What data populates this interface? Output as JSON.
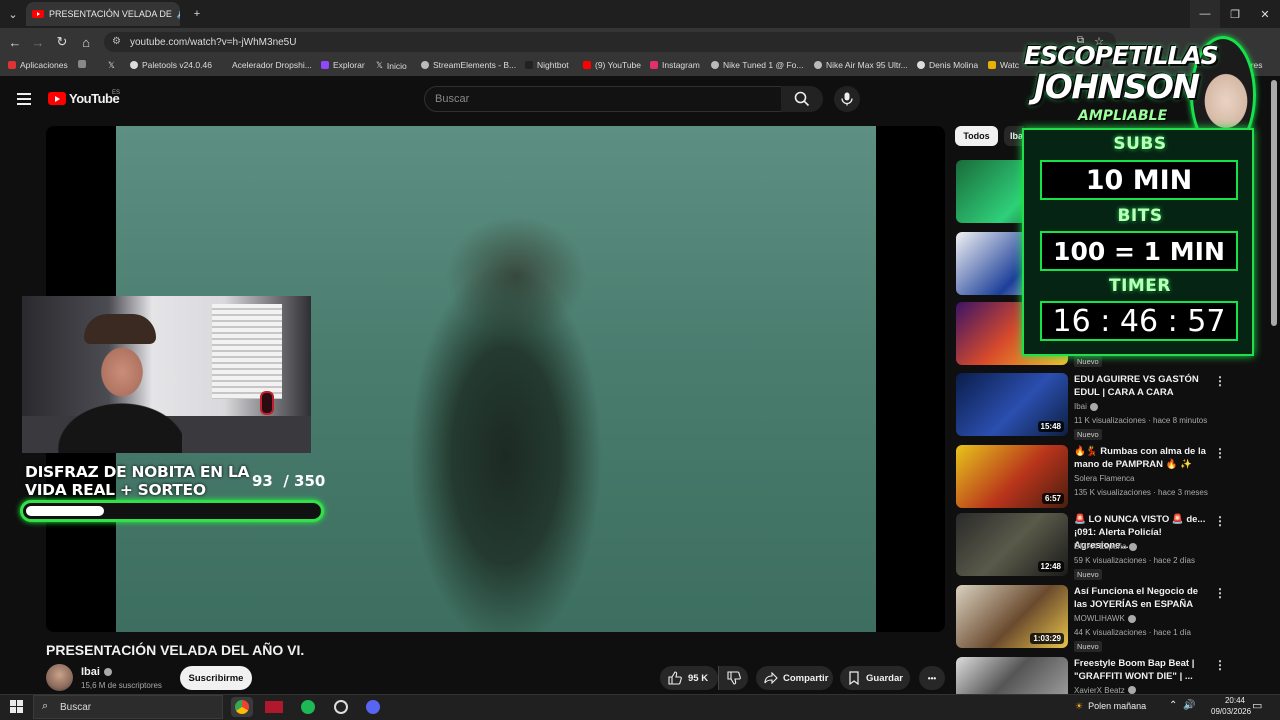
{
  "browser": {
    "tab_title": "PRESENTACIÓN VELADA DE",
    "url": "youtube.com/watch?v=h-jWhM3ne5U",
    "window_controls": {
      "minimize": "—",
      "restore": "❐",
      "close": "✕"
    },
    "bookmarks": [
      "Aplicaciones",
      "Paletools v24.0.46",
      "Acelerador Dropshi...",
      "Explorar",
      "Inicio",
      "StreamElements - B...",
      "Nightbot",
      "(9) YouTube",
      "Instagram",
      "Nike Tuned 1 @ Fo...",
      "Nike Air Max 95 Ultr...",
      "Denis Molina",
      "Watc",
      "bres"
    ]
  },
  "youtube": {
    "logo": "YouTube",
    "region": "ES",
    "search_placeholder": "Buscar",
    "chips": [
      "Todos",
      "Iba"
    ]
  },
  "video": {
    "title": "PRESENTACIÓN VELADA DEL AÑO VI.",
    "channel": "Ibai",
    "subscribers": "15,6 M de suscriptores",
    "subscribe_label": "Suscribirme",
    "likes": "95 K",
    "share_label": "Compartir",
    "save_label": "Guardar",
    "more_label": "•••"
  },
  "stream_goal": {
    "title_line1": "DISFRAZ DE NOBITA EN LA",
    "title_line2": "VIDA REAL + SORTEO",
    "current": "93",
    "target": "/ 350",
    "progress_fraction": 0.266
  },
  "subathon_overlay": {
    "title_line1": "ESCOPETILLAS",
    "title_line2": "JOHNSON",
    "subtitle": "AMPLIABLE",
    "subs_label": "SUBS",
    "subs_value": "10 MIN",
    "bits_label": "BITS",
    "bits_value": "100 = 1 MIN",
    "timer_label": "TIMER",
    "timer_value": "16 : 46 : 57"
  },
  "recommendations": [
    {
      "title": "EDU AGUIRRE VS GASTÓN EDUL | CARA A CARA",
      "channel": "Ibai",
      "meta": "11 K visualizaciones · hace 8 minutos",
      "duration": "15:48",
      "badge": "Nuevo"
    },
    {
      "title": "🔥💃 Rumbas con alma de la mano de PAMPRAN 🔥 ✨",
      "channel": "Solera Flamenca",
      "meta": "135 K visualizaciones · hace 3 meses",
      "duration": "6:57",
      "badge": ""
    },
    {
      "title": "🚨 LO NUNCA VISTO 🚨 de... ¡091: Alerta Policía! Agresione...",
      "channel": "DMAX España",
      "meta": "59 K visualizaciones · hace 2 días",
      "duration": "12:48",
      "badge": "Nuevo"
    },
    {
      "title": "Así Funciona el Negocio de las JOYERÍAS en ESPAÑA",
      "channel": "MOWLIHAWK",
      "meta": "44 K visualizaciones · hace 1 día",
      "duration": "1:03:29",
      "badge": "Nuevo"
    },
    {
      "title": "Freestyle Boom Bap Beat | \"GRAFFITI WONT DIE\" | ...",
      "channel": "XavierX Beatz",
      "meta": "",
      "duration": "",
      "badge": ""
    }
  ],
  "partial_rec_badge": "Nuevo",
  "taskbar": {
    "search_placeholder": "Buscar",
    "weather": "Polen mañana",
    "time": "20:44",
    "date": "09/03/2026"
  },
  "colors": {
    "goal_green": "#34e04a",
    "overlay_green": "#1fe04a",
    "youtube_red": "#ff0000"
  }
}
